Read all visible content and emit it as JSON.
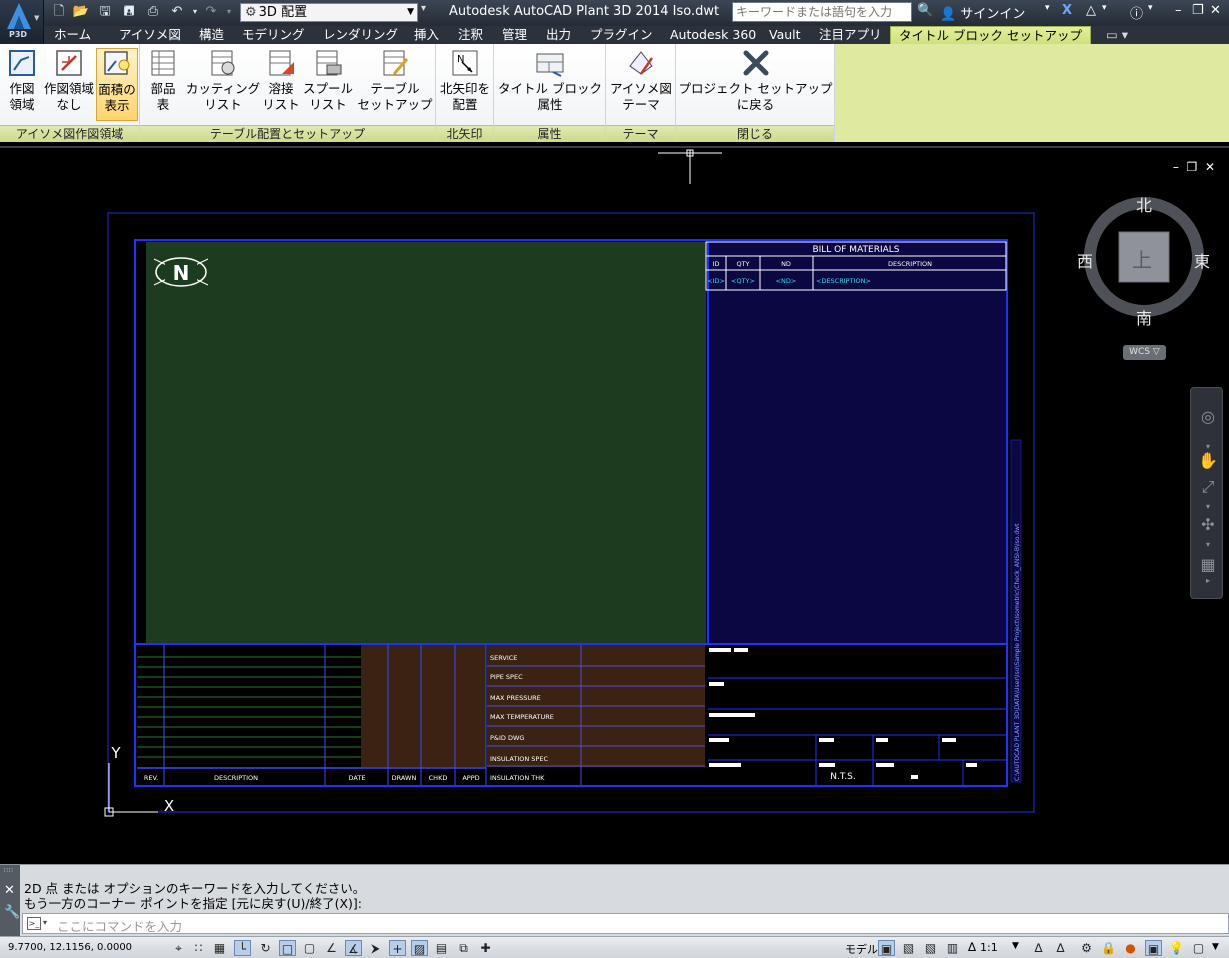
{
  "title_bar": {
    "app_sub": "P3D",
    "workspace": "3D 配置",
    "title": "Autodesk AutoCAD Plant 3D 2014    Iso.dwt",
    "search_placeholder": "キーワードまたは語句を入力",
    "signin": "サインイン"
  },
  "tabs": [
    {
      "label": "ホーム"
    },
    {
      "label": "アイソメ図"
    },
    {
      "label": "構造"
    },
    {
      "label": "モデリング"
    },
    {
      "label": "レンダリング"
    },
    {
      "label": "挿入"
    },
    {
      "label": "注釈"
    },
    {
      "label": "管理"
    },
    {
      "label": "出力"
    },
    {
      "label": "プラグイン"
    },
    {
      "label": "Autodesk 360"
    },
    {
      "label": "Vault"
    },
    {
      "label": "注目アプリ"
    },
    {
      "label": "タイトル ブロック セットアップ",
      "active": true
    }
  ],
  "ribbon": {
    "panels": [
      {
        "label": "アイソメ図作図領域",
        "buttons": [
          {
            "line1": "作図",
            "line2": "領域",
            "icon": "drawing-area-icon"
          },
          {
            "line1": "作図領域",
            "line2": "なし",
            "icon": "no-drawing-area-icon"
          },
          {
            "line1": "面積の",
            "line2": "表示",
            "icon": "show-area-icon",
            "selected": true
          }
        ]
      },
      {
        "label": "テーブル配置とセットアップ",
        "buttons": [
          {
            "line1": "部品",
            "line2": "表",
            "icon": "bom-table-icon"
          },
          {
            "line1": "カッティング",
            "line2": "リスト",
            "icon": "cut-list-icon"
          },
          {
            "line1": "溶接",
            "line2": "リスト",
            "icon": "weld-list-icon"
          },
          {
            "line1": "スプール",
            "line2": "リスト",
            "icon": "spool-list-icon"
          },
          {
            "line1": "テーブル",
            "line2": "セットアップ",
            "icon": "table-setup-icon"
          }
        ]
      },
      {
        "label": "北矢印",
        "buttons": [
          {
            "line1": "北矢印を",
            "line2": "配置",
            "icon": "north-arrow-icon"
          }
        ]
      },
      {
        "label": "属性",
        "buttons": [
          {
            "line1": "タイトル ブロック",
            "line2": "属性",
            "icon": "title-block-attr-icon"
          }
        ]
      },
      {
        "label": "テーマ",
        "buttons": [
          {
            "line1": "アイソメ図",
            "line2": "テーマ",
            "icon": "iso-theme-icon"
          }
        ]
      },
      {
        "label": "閉じる",
        "buttons": [
          {
            "line1": "プロジェクト セットアップ",
            "line2": "に戻る",
            "icon": "close-x-icon"
          }
        ]
      }
    ]
  },
  "viewcube": {
    "north": "北",
    "south": "南",
    "east": "東",
    "west": "西",
    "top": "上",
    "wcs": "WCS"
  },
  "ucs": {
    "y": "Y",
    "x": "X"
  },
  "drawing": {
    "north_symbol": "N",
    "bom": {
      "title": "BILL OF MATERIALS",
      "headers": [
        "ID",
        "QTY",
        "ND",
        "DESCRIPTION"
      ],
      "placeholders": [
        "<ID>",
        "<QTY>",
        "<ND>",
        "<DESCRIPTION>"
      ]
    },
    "info_labels": [
      "SERVICE",
      "PIPE SPEC",
      "MAX PRESSURE",
      "MAX TEMPERATURE",
      "P&ID DWG",
      "INSULATION SPEC",
      "INSULATION THK"
    ],
    "rev_headers": [
      "REV.",
      "DESCRIPTION",
      "DATE",
      "DRAWN",
      "CHKD",
      "APPD"
    ],
    "nts": "N.T.S.",
    "path_text": "C:\\AUTOCAD PLANT 3D\\DATA\\User\\Iso\\Sample Project\\Isometric\\Check_ANSI-B\\Iso.dwt"
  },
  "command": {
    "history": [
      "2D 点 または オプションのキーワードを入力してください。",
      "もう一方のコーナー ポイントを指定 [元に戻す(U)/終了(X)]:"
    ],
    "placeholder": "ここにコマンドを入力"
  },
  "status": {
    "coords": "9.7700, 12.1156, 0.0000",
    "model": "モデル",
    "scale": "1:1"
  }
}
